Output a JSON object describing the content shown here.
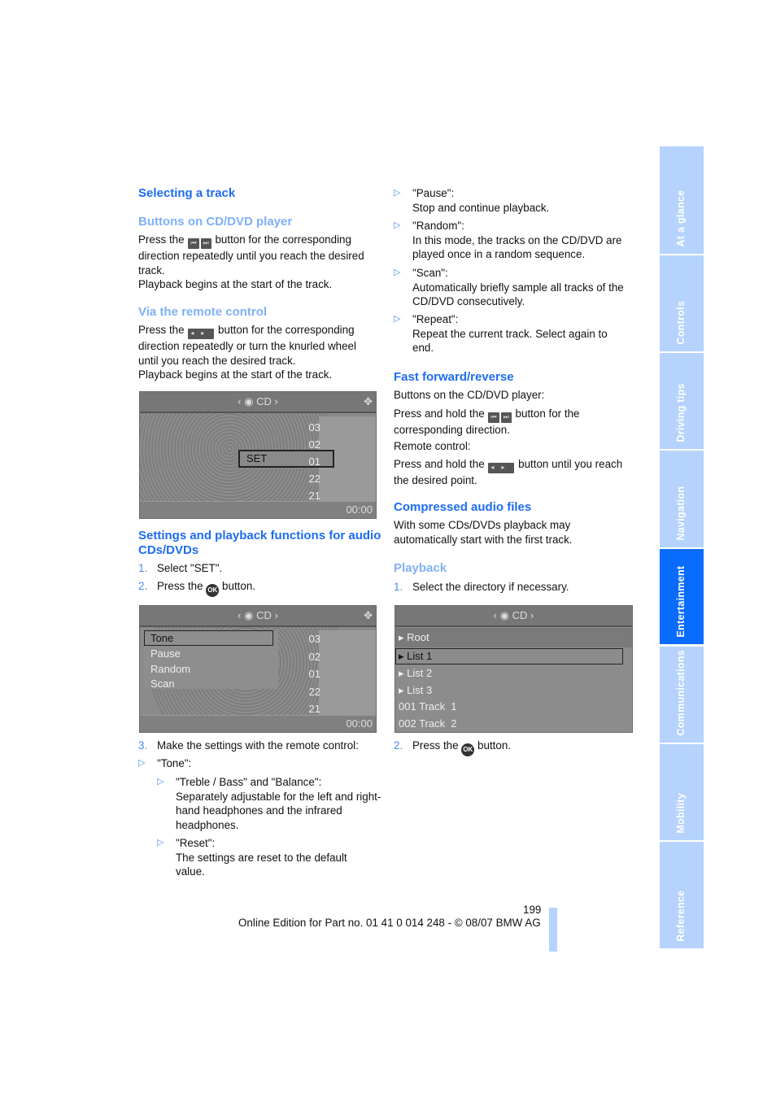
{
  "left": {
    "h_select": "Selecting a track",
    "h_buttons": "Buttons on CD/DVD player",
    "p_buttons_a": "Press the",
    "p_buttons_b": "button for the corresponding direction repeatedly until you reach the desired track.",
    "p_buttons_c": "Playback begins at the start of the track.",
    "h_remote": "Via the remote control",
    "p_remote_a": "Press the",
    "p_remote_b": "button for the corresponding direction repeatedly or turn the knurled wheel until you reach the desired track.",
    "p_remote_c": "Playback begins at the start of the track.",
    "h_settings": "Settings and playback functions for audio CDs/DVDs",
    "steps": [
      {
        "n": "1.",
        "text": "Select \"SET\"."
      },
      {
        "n": "2.",
        "a": "Press the",
        "b": "button."
      }
    ],
    "step3": {
      "n": "3.",
      "text": "Make the settings with the remote control:"
    },
    "tone": "\"Tone\":",
    "treble": {
      "title": "\"Treble / Bass\" and \"Balance\":",
      "text": "Separately adjustable for the left and right-hand headphones and the infrared headphones."
    },
    "reset": {
      "title": "\"Reset\":",
      "text": "The settings are reset to the default value."
    }
  },
  "right": {
    "bullets": [
      {
        "title": "\"Pause\":",
        "text": "Stop and continue playback."
      },
      {
        "title": "\"Random\":",
        "text": "In this mode, the tracks on the CD/DVD are played once in a random sequence."
      },
      {
        "title": "\"Scan\":",
        "text": "Automatically briefly sample all tracks of the CD/DVD consecutively."
      },
      {
        "title": "\"Repeat\":",
        "text": "Repeat the current track. Select again to end."
      }
    ],
    "h_ff": "Fast forward/reverse",
    "ff_1": "Buttons on the CD/DVD player:",
    "ff_2a": "Press and hold the",
    "ff_2b": "button for the corresponding direction.",
    "ff_3": "Remote control:",
    "ff_4a": "Press and hold the",
    "ff_4b": "button until you reach the desired point.",
    "h_comp": "Compressed audio files",
    "comp": "With some CDs/DVDs playback may automatically start with the first track.",
    "h_play": "Playback",
    "play1": {
      "n": "1.",
      "text": "Select the directory if necessary."
    },
    "play2": {
      "n": "2.",
      "a": "Press the",
      "b": "button."
    }
  },
  "icons": {
    "prev": "⏮",
    "next": "⏭",
    "rocker_l": "◂",
    "rocker_r": "▸",
    "ok": "OK",
    "bullet": "▷"
  },
  "screen1": {
    "source": "CD",
    "tracks": [
      "03",
      "02",
      "01",
      "22",
      "21"
    ],
    "selected_label": "SET",
    "time": "00:00"
  },
  "screen2": {
    "source": "CD",
    "menu": [
      "Tone",
      "Pause",
      "Random",
      "Scan"
    ],
    "tracks": [
      "03",
      "02",
      "01",
      "22",
      "21"
    ],
    "time": "00:00"
  },
  "screen3": {
    "source": "CD",
    "items": [
      "Root",
      "List 1",
      "List 2",
      "List 3",
      "001 Track  1",
      "002 Track  2"
    ]
  },
  "sidebar": {
    "tabs": [
      "At a glance",
      "Controls",
      "Driving tips",
      "Navigation",
      "Entertainment",
      "Communications",
      "Mobility",
      "Reference"
    ],
    "active": "Entertainment"
  },
  "footer": {
    "page": "199",
    "edition": "Online Edition for Part no. 01 41 0 014 248 - © 08/07 BMW AG"
  },
  "colors": {
    "heading": "#1e6cf0",
    "subheading": "#7fb0f7",
    "tab": "#b5d3fd",
    "tab_active": "#0a6cff"
  }
}
